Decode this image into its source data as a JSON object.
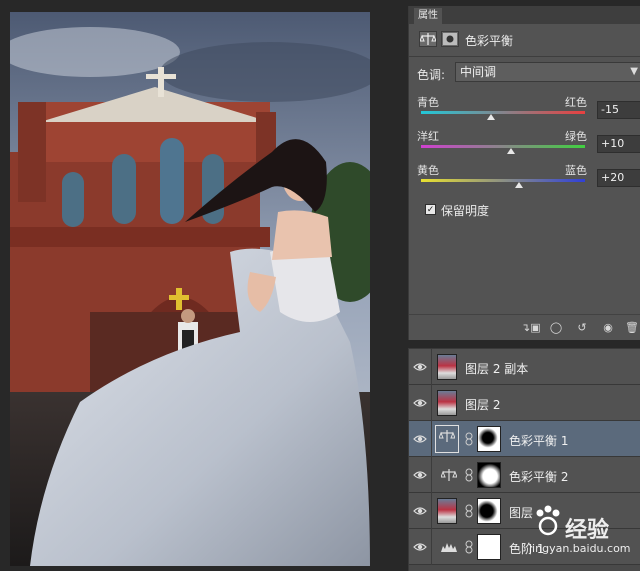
{
  "properties_panel": {
    "tab": "属性",
    "title": "色彩平衡",
    "tone_label": "色调:",
    "tone_value": "中间调",
    "sliders": [
      {
        "left_label": "青色",
        "right_label": "红色",
        "value": "-15",
        "position": -15,
        "colors": [
          "#22c8d8",
          "#e84040"
        ]
      },
      {
        "left_label": "洋红",
        "right_label": "绿色",
        "value": "+10",
        "position": 10,
        "colors": [
          "#d040d0",
          "#40d040"
        ]
      },
      {
        "left_label": "黄色",
        "right_label": "蓝色",
        "value": "+20",
        "position": 20,
        "colors": [
          "#e8e030",
          "#3040d8"
        ]
      }
    ],
    "preserve_luminosity": {
      "label": "保留明度",
      "checked": true
    }
  },
  "layers": [
    {
      "name": "图层 2 副本",
      "type": "photo",
      "visible": true,
      "selected": false
    },
    {
      "name": "图层 2",
      "type": "photo",
      "visible": true,
      "selected": false
    },
    {
      "name": "色彩平衡 1",
      "type": "color-balance",
      "visible": true,
      "selected": true
    },
    {
      "name": "色彩平衡 2",
      "type": "color-balance",
      "visible": true,
      "selected": false
    },
    {
      "name": "图层",
      "type": "photo-mask",
      "visible": true,
      "selected": false
    },
    {
      "name": "色阶 1",
      "type": "levels",
      "visible": true,
      "selected": false
    }
  ],
  "watermark": {
    "text": "经验",
    "url": "jingyan.baidu.com"
  },
  "colors": {
    "panel": "#535353",
    "selected_layer": "#5b6a7c",
    "background": "#282828"
  }
}
